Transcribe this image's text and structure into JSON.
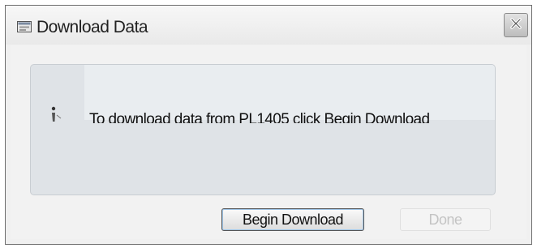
{
  "window": {
    "title": "Download Data",
    "title_icon": "download-window-icon",
    "close_icon": "close-icon"
  },
  "content": {
    "info_icon": "info-icon",
    "message": "To download data from PL1405 click Begin Download"
  },
  "buttons": {
    "begin_label": "Begin Download",
    "done_label": "Done",
    "done_enabled": false
  },
  "colors": {
    "panel_background": "#dfe3e7",
    "window_background": "#f0f0f0",
    "disabled_text": "#c4c4c4"
  }
}
